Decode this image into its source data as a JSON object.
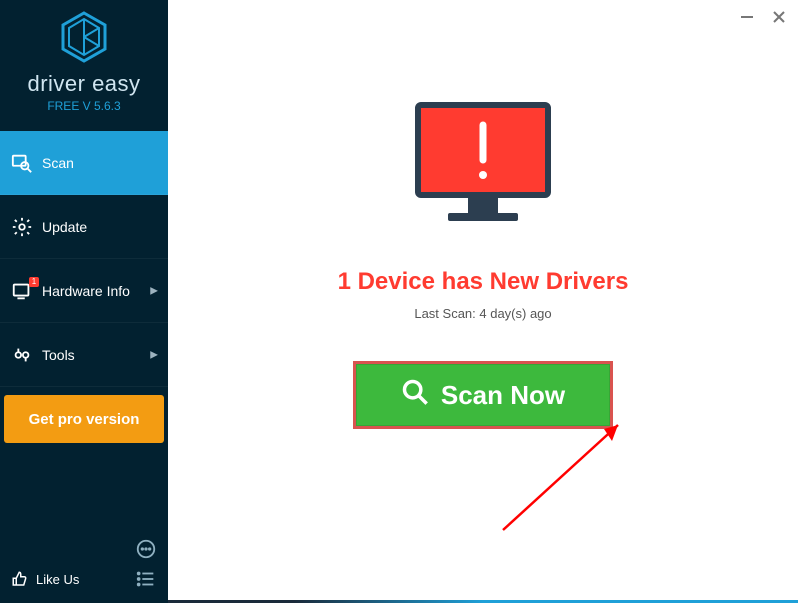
{
  "brand": {
    "name": "driver easy",
    "version": "FREE V 5.6.3"
  },
  "sidebar": {
    "items": [
      {
        "label": "Scan",
        "active": true,
        "chevron": false
      },
      {
        "label": "Update",
        "active": false,
        "chevron": false
      },
      {
        "label": "Hardware Info",
        "active": false,
        "chevron": true,
        "badge": "1"
      },
      {
        "label": "Tools",
        "active": false,
        "chevron": true
      }
    ],
    "pro_label": "Get pro version",
    "like_label": "Like Us"
  },
  "main": {
    "headline": "1 Device has New Drivers",
    "last_scan": "Last Scan: 4 day(s) ago",
    "scan_button": "Scan Now"
  },
  "colors": {
    "accent": "#1fa0d8",
    "alert": "#ff3b30",
    "scan_green": "#3db93d",
    "pro_orange": "#f39c12"
  }
}
